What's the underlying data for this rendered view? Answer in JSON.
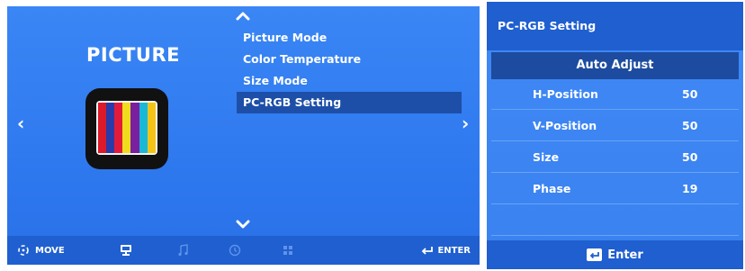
{
  "picture_menu": {
    "title": "PICTURE",
    "items": [
      {
        "label": "Picture Mode",
        "selected": false
      },
      {
        "label": "Color Temperature",
        "selected": false
      },
      {
        "label": "Size Mode",
        "selected": false
      },
      {
        "label": "PC-RGB Setting",
        "selected": true
      }
    ],
    "nav_left": "‹",
    "nav_right": "›",
    "footer": {
      "move_label": "MOVE",
      "enter_label": "ENTER",
      "tabs": [
        "monitor-icon",
        "music-icon",
        "clock-icon",
        "grid-icon"
      ]
    }
  },
  "pc_rgb": {
    "title": "PC-RGB Setting",
    "auto_adjust": "Auto Adjust",
    "rows": [
      {
        "label": "H-Position",
        "value": "50"
      },
      {
        "label": "V-Position",
        "value": "50"
      },
      {
        "label": "Size",
        "value": "50"
      },
      {
        "label": "Phase",
        "value": "19"
      }
    ],
    "footer_label": "Enter"
  },
  "colors": {
    "panel_blue": "#2f7bf0",
    "footer_blue": "#1f5fd0",
    "selected_blue": "#1d4fa8",
    "text": "#ffffff"
  }
}
